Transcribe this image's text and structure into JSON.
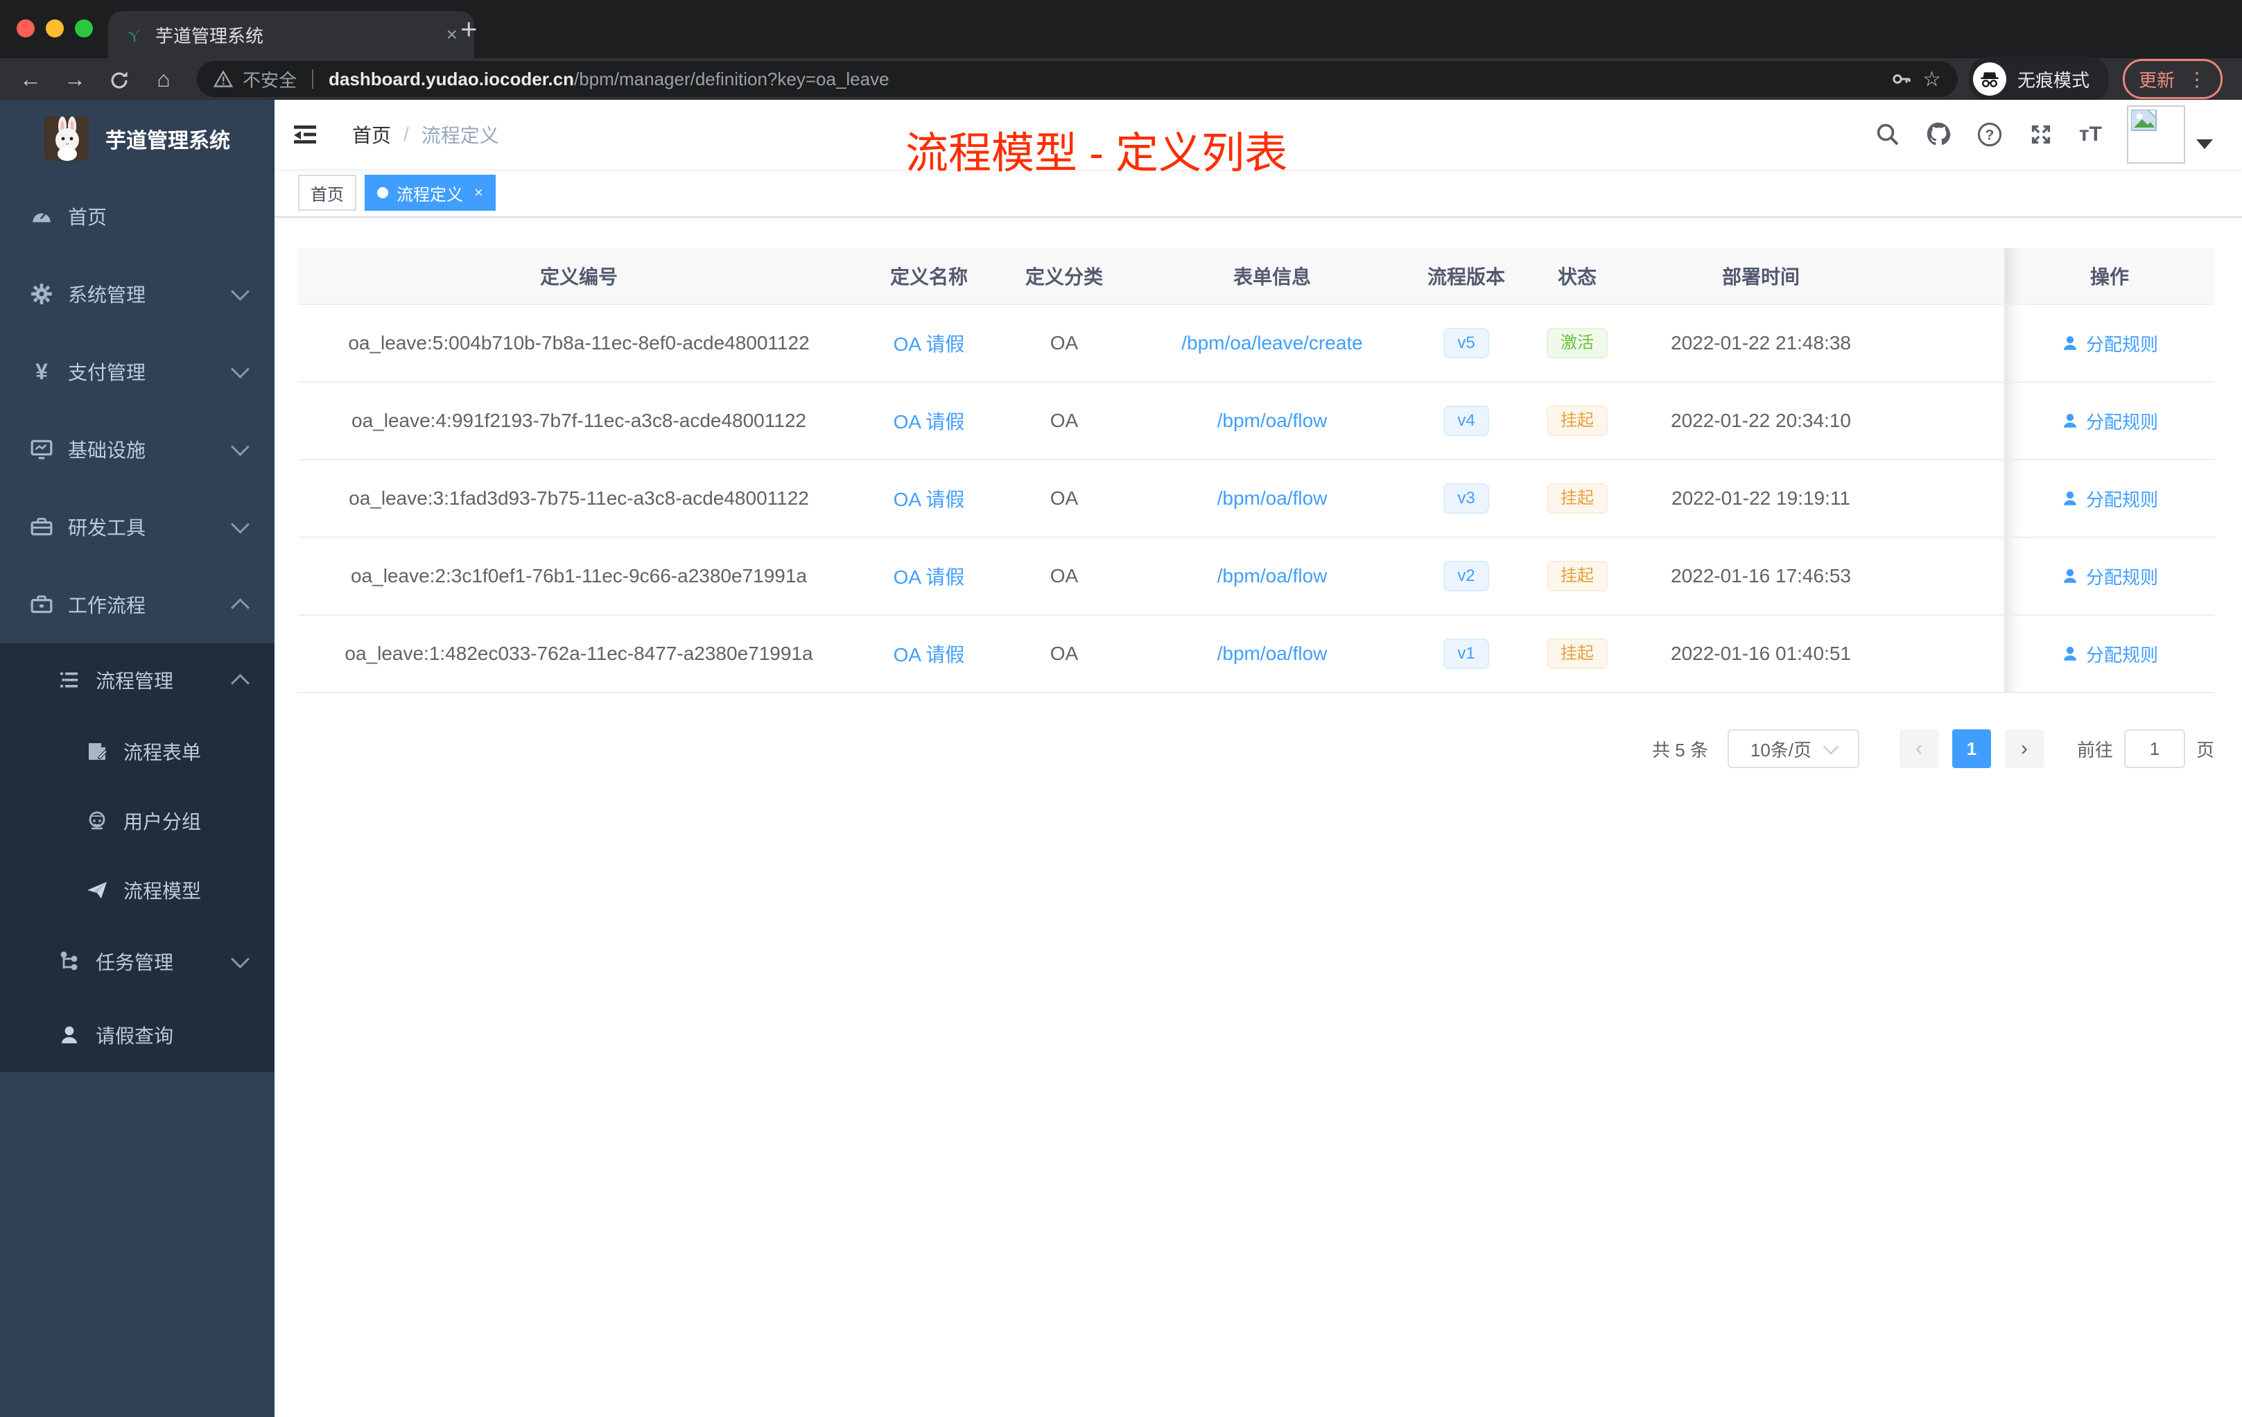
{
  "browser": {
    "tab_title": "芋道管理系统",
    "tab_close": "×",
    "new_tab": "+",
    "back_arrow": "←",
    "forward_arrow": "→",
    "home_glyph": "⌂",
    "security_label": "不安全",
    "url_host": "dashboard.yudao.iocoder.cn",
    "url_path": "/bpm/manager/definition?key=oa_leave",
    "star_glyph": "☆",
    "incognito_label": "无痕模式",
    "update_label": "更新",
    "menu_dots": "⋮",
    "colors": {
      "traffic_red": "#ff5f57",
      "traffic_yellow": "#febc2e",
      "traffic_green": "#28c840",
      "update_accent": "#f28b82"
    }
  },
  "sidebar": {
    "logo_title": "芋道管理系统",
    "menu": [
      {
        "label": "首页"
      },
      {
        "label": "系统管理"
      },
      {
        "label": "支付管理"
      },
      {
        "label": "基础设施"
      },
      {
        "label": "研发工具"
      },
      {
        "label": "工作流程"
      }
    ],
    "submenu": [
      {
        "label": "流程管理"
      },
      {
        "label": "流程表单"
      },
      {
        "label": "用户分组"
      },
      {
        "label": "流程模型"
      },
      {
        "label": "任务管理"
      },
      {
        "label": "请假查询"
      }
    ]
  },
  "navbar": {
    "breadcrumb_home": "首页",
    "breadcrumb_sep": "/",
    "breadcrumb_current": "流程定义",
    "annotation": "流程模型 - 定义列表",
    "annotation_color": "#ff2d00"
  },
  "tags": {
    "home": "首页",
    "current": "流程定义",
    "close": "×"
  },
  "table": {
    "columns": [
      "定义编号",
      "定义名称",
      "定义分类",
      "表单信息",
      "流程版本",
      "状态",
      "部署时间",
      "操作"
    ],
    "action_label": "分配规则",
    "rows": [
      {
        "id": "oa_leave:5:004b710b-7b8a-11ec-8ef0-acde48001122",
        "name": "OA 请假",
        "category": "OA",
        "form": "/bpm/oa/leave/create",
        "version": "v5",
        "status": "激活",
        "time": "2022-01-22 21:48:38"
      },
      {
        "id": "oa_leave:4:991f2193-7b7f-11ec-a3c8-acde48001122",
        "name": "OA 请假",
        "category": "OA",
        "form": "/bpm/oa/flow",
        "version": "v4",
        "status": "挂起",
        "time": "2022-01-22 20:34:10"
      },
      {
        "id": "oa_leave:3:1fad3d93-7b75-11ec-a3c8-acde48001122",
        "name": "OA 请假",
        "category": "OA",
        "form": "/bpm/oa/flow",
        "version": "v3",
        "status": "挂起",
        "time": "2022-01-22 19:19:11"
      },
      {
        "id": "oa_leave:2:3c1f0ef1-76b1-11ec-9c66-a2380e71991a",
        "name": "OA 请假",
        "category": "OA",
        "form": "/bpm/oa/flow",
        "version": "v2",
        "status": "挂起",
        "time": "2022-01-16 17:46:53"
      },
      {
        "id": "oa_leave:1:482ec033-762a-11ec-8477-a2380e71991a",
        "name": "OA 请假",
        "category": "OA",
        "form": "/bpm/oa/flow",
        "version": "v1",
        "status": "挂起",
        "time": "2022-01-16 01:40:51"
      }
    ]
  },
  "pagination": {
    "total": "共 5 条",
    "page_size": "10条/页",
    "prev": "‹",
    "current_page": "1",
    "next": "›",
    "goto_label": "前往",
    "goto_value": "1",
    "page_unit": "页"
  }
}
